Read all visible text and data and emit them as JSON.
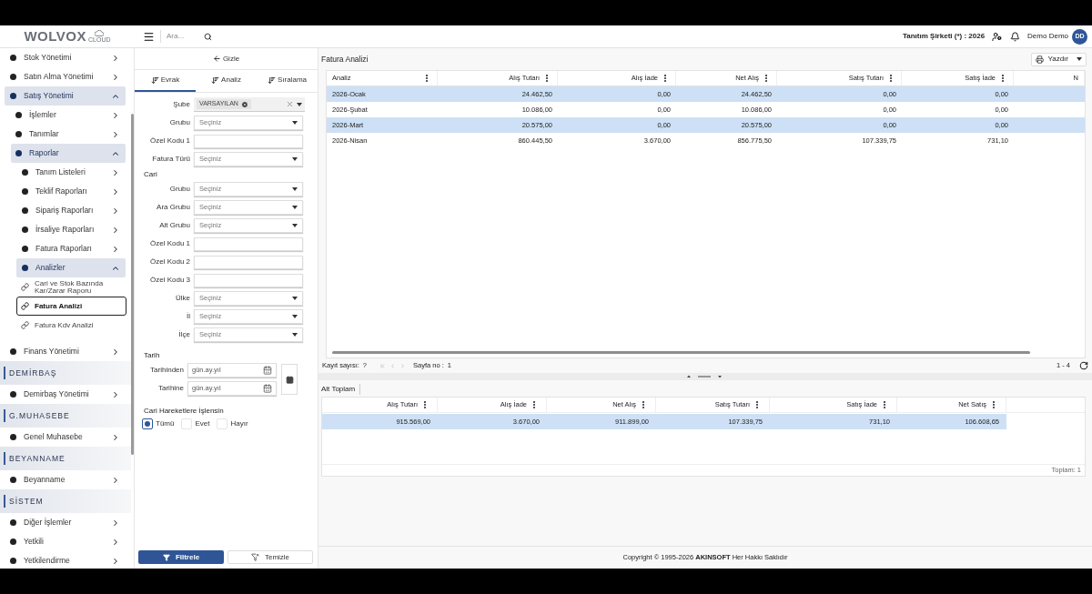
{
  "header": {
    "logo_main": "WOLVOX",
    "logo_sub": "CLOUD",
    "search_placeholder": "Ara...",
    "company": "Tanıtım Şirketi (*) : 2026",
    "user": "Demo Demo",
    "avatar": "DD"
  },
  "sidebar": {
    "sections": [
      {
        "items": [
          {
            "label": "Stok Yönetimi",
            "kind": "group",
            "expanded": false
          },
          {
            "label": "Satın Alma Yönetimi",
            "kind": "group",
            "expanded": false
          },
          {
            "label": "Satış Yönetimi",
            "kind": "group",
            "expanded": true,
            "children": [
              {
                "label": "İşlemler",
                "kind": "group",
                "expanded": false
              },
              {
                "label": "Tanımlar",
                "kind": "group",
                "expanded": false
              },
              {
                "label": "Raporlar",
                "kind": "group",
                "expanded": true,
                "children": [
                  {
                    "label": "Tanım Listeleri",
                    "kind": "group",
                    "expanded": false
                  },
                  {
                    "label": "Teklif Raporları",
                    "kind": "group",
                    "expanded": false
                  },
                  {
                    "label": "Sipariş Raporları",
                    "kind": "group",
                    "expanded": false
                  },
                  {
                    "label": "İrsaliye Raporları",
                    "kind": "group",
                    "expanded": false
                  },
                  {
                    "label": "Fatura Raporları",
                    "kind": "group",
                    "expanded": false
                  },
                  {
                    "label": "Analizler",
                    "kind": "group",
                    "expanded": true,
                    "children": [
                      {
                        "label": "Cari ve Stok Bazında Kar/Zarar Raporu",
                        "kind": "link",
                        "selected": false
                      },
                      {
                        "label": "Fatura Analizi",
                        "kind": "link",
                        "selected": true
                      },
                      {
                        "label": "Fatura Kdv Analizi",
                        "kind": "link",
                        "selected": false
                      }
                    ]
                  }
                ]
              }
            ]
          },
          {
            "label": "Finans Yönetimi",
            "kind": "group",
            "expanded": false
          }
        ]
      },
      {
        "title": "DEMİRBAŞ",
        "items": [
          {
            "label": "Demirbaş Yönetimi",
            "kind": "group",
            "expanded": false
          }
        ]
      },
      {
        "title": "G.MUHASEBE",
        "items": [
          {
            "label": "Genel Muhasebe",
            "kind": "group",
            "expanded": false
          }
        ]
      },
      {
        "title": "BEYANNAME",
        "items": [
          {
            "label": "Beyanname",
            "kind": "group",
            "expanded": false
          }
        ]
      },
      {
        "title": "SİSTEM",
        "items": [
          {
            "label": "Diğer İşlemler",
            "kind": "group",
            "expanded": false
          },
          {
            "label": "Yetkili",
            "kind": "group",
            "expanded": false
          },
          {
            "label": "Yetkilendirme",
            "kind": "group",
            "expanded": false
          }
        ]
      }
    ]
  },
  "filter_panel": {
    "hide_button": "Gizle",
    "tabs": [
      {
        "label": "Evrak",
        "selected": true
      },
      {
        "label": "Analiz",
        "selected": false
      },
      {
        "label": "Sıralama",
        "selected": false
      }
    ],
    "fields": [
      {
        "label": "Şube",
        "kind": "tags",
        "tags": [
          "VARSAYILAN"
        ]
      },
      {
        "label": "Grubu",
        "kind": "select",
        "placeholder": "Seçiniz"
      },
      {
        "label": "Özel Kodu 1",
        "kind": "text"
      },
      {
        "label": "Fatura Türü",
        "kind": "select",
        "placeholder": "Seçiniz"
      }
    ],
    "cari": {
      "title": "Cari",
      "fields": [
        {
          "label": "Grubu",
          "kind": "select",
          "placeholder": "Seçiniz"
        },
        {
          "label": "Ara Grubu",
          "kind": "select",
          "placeholder": "Seçiniz"
        },
        {
          "label": "Alt Grubu",
          "kind": "select",
          "placeholder": "Seçiniz"
        },
        {
          "label": "Özel Kodu 1",
          "kind": "text"
        },
        {
          "label": "Özel Kodu 2",
          "kind": "text"
        },
        {
          "label": "Özel Kodu 3",
          "kind": "text"
        },
        {
          "label": "Ülke",
          "kind": "select",
          "placeholder": "Seçiniz"
        },
        {
          "label": "İl",
          "kind": "select",
          "placeholder": "Seçiniz"
        },
        {
          "label": "İlçe",
          "kind": "select",
          "placeholder": "Seçiniz"
        }
      ]
    },
    "tarih": {
      "title": "Tarih",
      "fields": [
        {
          "label": "Tarihinden",
          "placeholder": "gün.ay.yıl"
        },
        {
          "label": "Tarihine",
          "placeholder": "gün.ay.yıl"
        }
      ]
    },
    "cari_hareket": {
      "title": "Cari Hareketlere İşlensin",
      "options": [
        {
          "label": "Tümü",
          "selected": true
        },
        {
          "label": "Evet",
          "selected": false
        },
        {
          "label": "Hayır",
          "selected": false
        }
      ]
    },
    "filter_button": "Filtrele",
    "clear_button": "Temizle"
  },
  "main": {
    "title": "Fatura Analizi",
    "print_button": "Yazdır",
    "table": {
      "columns": [
        "Analiz",
        "Alış Tutarı",
        "Alış İade",
        "Net Alış",
        "Satış Tutarı",
        "Satış İade",
        "N"
      ],
      "rows": [
        [
          "2026-Ocak",
          "24.462,50",
          "0,00",
          "24.462,50",
          "0,00",
          "0,00"
        ],
        [
          "2026-Şubat",
          "10.086,00",
          "0,00",
          "10.086,00",
          "0,00",
          "0,00"
        ],
        [
          "2026-Mart",
          "20.575,00",
          "0,00",
          "20.575,00",
          "0,00",
          "0,00"
        ],
        [
          "2026-Nisan",
          "860.445,50",
          "3.670,00",
          "856.775,50",
          "107.339,75",
          "731,10"
        ]
      ]
    },
    "pager": {
      "record_label": "Kayıt sayısı:",
      "record_value": "?",
      "page_label": "Sayfa no :",
      "page_value": "1",
      "range": "1 - 4"
    },
    "subtotal": {
      "tab": "Alt Toplam",
      "columns": [
        "Alış Tutarı",
        "Alış İade",
        "Net Alış",
        "Satış Tutarı",
        "Satış İade",
        "Net Satış"
      ],
      "rows": [
        [
          "915.569,00",
          "3.670,00",
          "911.899,00",
          "107.339,75",
          "731,10",
          "106.608,65"
        ]
      ],
      "total": "Toplam: 1"
    }
  },
  "footer": {
    "copyright": "Copyright © 1995-2026 **AKINSOFT** Her Hakkı Saklıdır"
  }
}
